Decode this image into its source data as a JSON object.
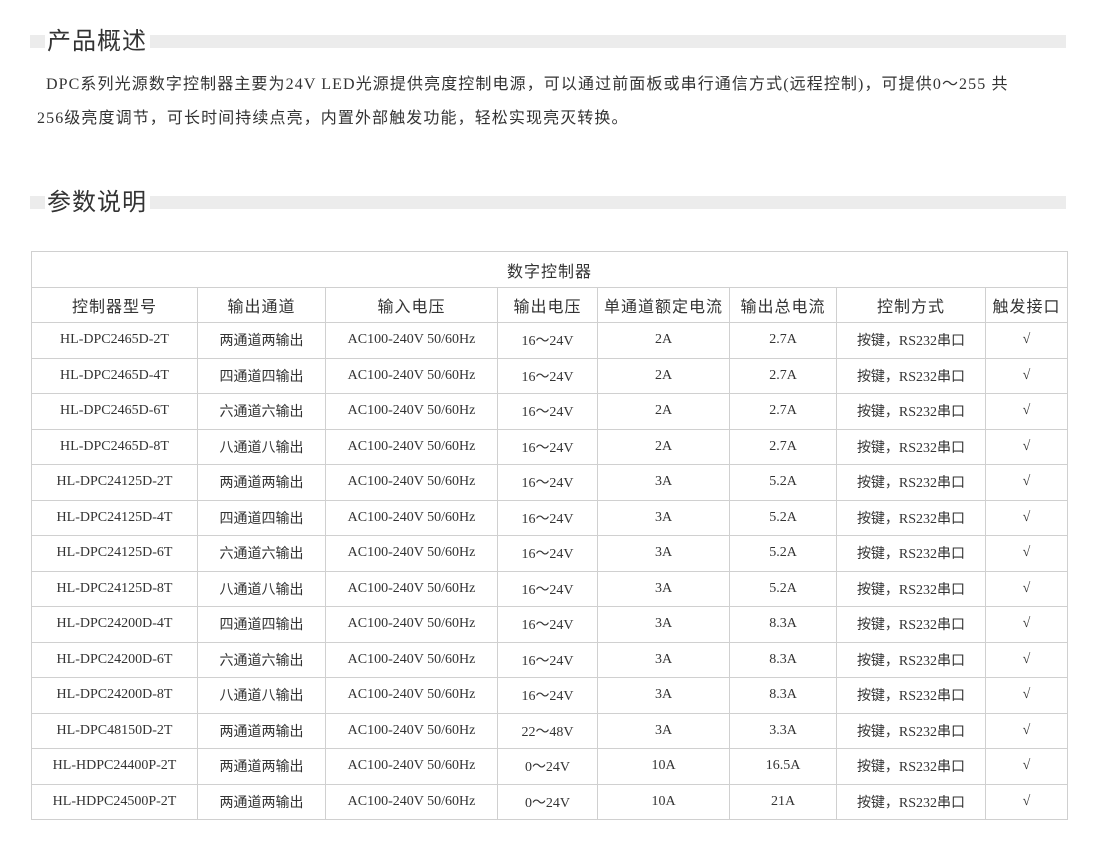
{
  "overview": {
    "title": "产品概述",
    "paragraph_lines": [
      "DPC系列光源数字控制器主要为24V LED光源提供亮度控制电源，可以通过前面板或串行通信方式(远程控制)，可提供0～255 共",
      "256级亮度调节，可长时间持续点亮，内置外部触发功能，轻松实现亮灭转换。"
    ]
  },
  "params": {
    "title": "参数说明",
    "table": {
      "caption": "数字控制器",
      "columns": [
        "控制器型号",
        "输出通道",
        "输入电压",
        "输出电压",
        "单通道额定电流",
        "输出总电流",
        "控制方式",
        "触发接口"
      ],
      "rows": [
        [
          "HL-DPC2465D-2T",
          "两通道两输出",
          "AC100-240V 50/60Hz",
          "16～24V",
          "2A",
          "2.7A",
          "按键，RS232串口",
          "√"
        ],
        [
          "HL-DPC2465D-4T",
          "四通道四输出",
          "AC100-240V 50/60Hz",
          "16～24V",
          "2A",
          "2.7A",
          "按键，RS232串口",
          "√"
        ],
        [
          "HL-DPC2465D-6T",
          "六通道六输出",
          "AC100-240V 50/60Hz",
          "16～24V",
          "2A",
          "2.7A",
          "按键，RS232串口",
          "√"
        ],
        [
          "HL-DPC2465D-8T",
          "八通道八输出",
          "AC100-240V 50/60Hz",
          "16～24V",
          "2A",
          "2.7A",
          "按键，RS232串口",
          "√"
        ],
        [
          "HL-DPC24125D-2T",
          "两通道两输出",
          "AC100-240V 50/60Hz",
          "16～24V",
          "3A",
          "5.2A",
          "按键，RS232串口",
          "√"
        ],
        [
          "HL-DPC24125D-4T",
          "四通道四输出",
          "AC100-240V 50/60Hz",
          "16～24V",
          "3A",
          "5.2A",
          "按键，RS232串口",
          "√"
        ],
        [
          "HL-DPC24125D-6T",
          "六通道六输出",
          "AC100-240V 50/60Hz",
          "16～24V",
          "3A",
          "5.2A",
          "按键，RS232串口",
          "√"
        ],
        [
          "HL-DPC24125D-8T",
          "八通道八输出",
          "AC100-240V 50/60Hz",
          "16～24V",
          "3A",
          "5.2A",
          "按键，RS232串口",
          "√"
        ],
        [
          "HL-DPC24200D-4T",
          "四通道四输出",
          "AC100-240V 50/60Hz",
          "16～24V",
          "3A",
          "8.3A",
          "按键，RS232串口",
          "√"
        ],
        [
          "HL-DPC24200D-6T",
          "六通道六输出",
          "AC100-240V 50/60Hz",
          "16～24V",
          "3A",
          "8.3A",
          "按键，RS232串口",
          "√"
        ],
        [
          "HL-DPC24200D-8T",
          "八通道八输出",
          "AC100-240V 50/60Hz",
          "16～24V",
          "3A",
          "8.3A",
          "按键，RS232串口",
          "√"
        ],
        [
          "HL-DPC48150D-2T",
          "两通道两输出",
          "AC100-240V 50/60Hz",
          "22～48V",
          "3A",
          "3.3A",
          "按键，RS232串口",
          "√"
        ],
        [
          "HL-HDPC24400P-2T",
          "两通道两输出",
          "AC100-240V 50/60Hz",
          "0～24V",
          "10A",
          "16.5A",
          "按键，RS232串口",
          "√"
        ],
        [
          "HL-HDPC24500P-2T",
          "两通道两输出",
          "AC100-240V 50/60Hz",
          "0～24V",
          "10A",
          "21A",
          "按键，RS232串口",
          "√"
        ]
      ]
    }
  }
}
